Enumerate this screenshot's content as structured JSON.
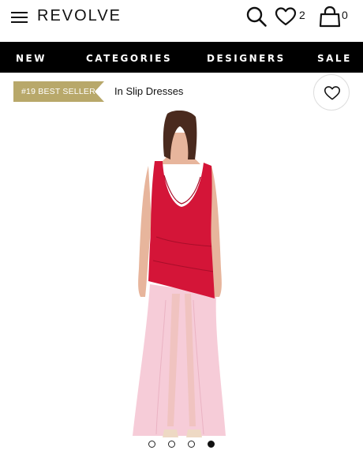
{
  "header": {
    "logo": "REVOLVE",
    "wishlist_count": "2",
    "bag_count": "0",
    "icons": [
      "menu-icon",
      "search-icon",
      "heart-icon",
      "bag-icon"
    ]
  },
  "nav": {
    "items": [
      {
        "label": "NEW"
      },
      {
        "label": "CATEGORIES"
      },
      {
        "label": "DESIGNERS"
      },
      {
        "label": "SALE"
      }
    ]
  },
  "product": {
    "badge": "#19 BEST SELLER",
    "category": "In Slip Dresses",
    "badge_color": "#b8a86a",
    "dress_top_color": "#d41538",
    "dress_skirt_color": "#f5c6d4"
  },
  "carousel": {
    "total": 4,
    "active_index": 3
  }
}
